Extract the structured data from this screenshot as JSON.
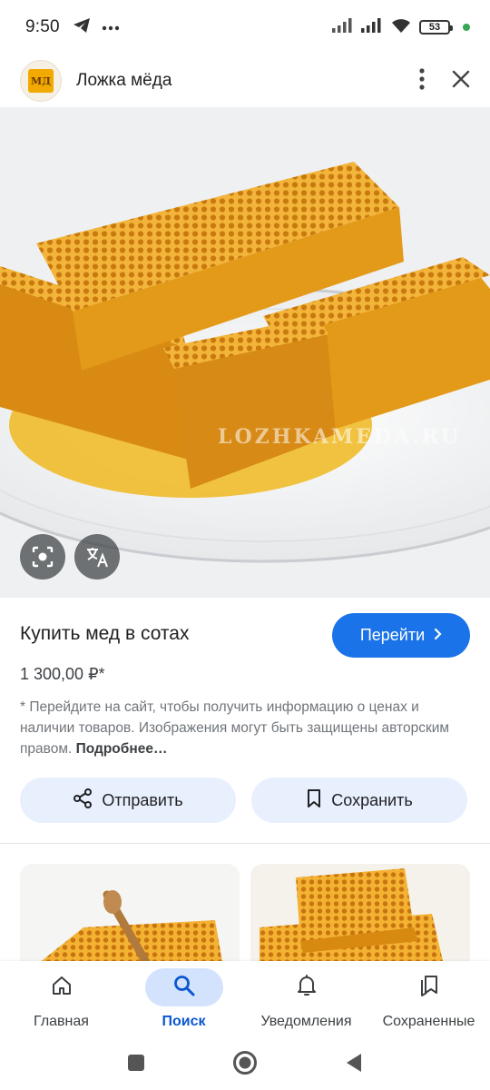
{
  "status_bar": {
    "time": "9:50",
    "battery_level": "53",
    "icons": [
      "telegram-icon",
      "more-dots-icon",
      "signal-icon",
      "signal-icon",
      "wifi-icon",
      "battery-icon"
    ]
  },
  "header": {
    "title": "Ложка мёда",
    "logo_text": "МД",
    "icons": [
      "more-vert-icon",
      "close-icon"
    ]
  },
  "hero": {
    "watermark": "LOZHKAMEDA.RU",
    "icons": [
      "lens-icon",
      "translate-icon"
    ]
  },
  "product": {
    "title": "Купить мед в сотах",
    "price": "1 300,00 ₽*",
    "goto_label": "Перейти",
    "disclaimer": "* Перейдите на сайт, чтобы получить информацию о ценах и наличии товаров. Изображения могут быть защищены авторским правом.",
    "more_link": "Подробнее…"
  },
  "actions": {
    "share_label": "Отправить",
    "save_label": "Сохранить"
  },
  "bottom_nav": {
    "items": [
      {
        "label": "Главная",
        "icon": "home-icon",
        "active": false
      },
      {
        "label": "Поиск",
        "icon": "search-icon",
        "active": true
      },
      {
        "label": "Уведомления",
        "icon": "bell-icon",
        "active": false
      },
      {
        "label": "Сохраненные",
        "icon": "bookmarks-icon",
        "active": false
      }
    ]
  },
  "colors": {
    "accent": "#1a73e8",
    "chip_background": "#e8f0fe",
    "active_nav_pill": "#d3e3fd",
    "active_nav_text": "#0b57d0",
    "honey": "#e9a21c"
  }
}
